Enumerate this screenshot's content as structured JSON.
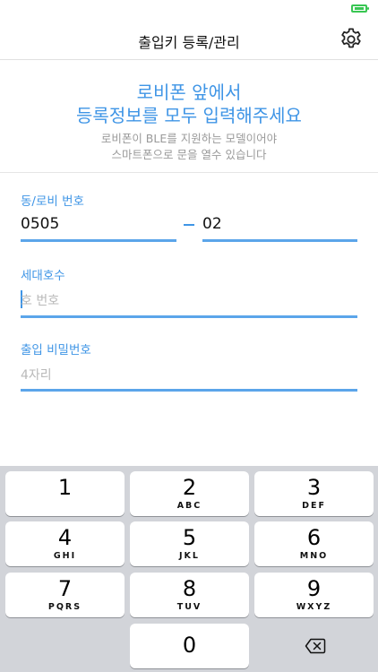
{
  "nav": {
    "title": "출입키 등록/관리",
    "settings_icon": "gear-icon"
  },
  "intro": {
    "headline_line1": "로비폰 앞에서",
    "headline_line2": "등록정보를 모두 입력해주세요",
    "sub_line1": "로비폰이 BLE를 지원하는 모델이어야",
    "sub_line2": "스마트폰으로 문을 열수 있습니다"
  },
  "form": {
    "dong_lobby": {
      "label": "동/로비 번호",
      "dong_value": "0505",
      "separator": "–",
      "lobby_value": "02"
    },
    "unit": {
      "label": "세대호수",
      "placeholder": "호 번호",
      "value": ""
    },
    "password": {
      "label": "출입 비밀번호",
      "placeholder": "4자리",
      "value": ""
    }
  },
  "keyboard": {
    "keys": [
      {
        "num": "1",
        "letters": ""
      },
      {
        "num": "2",
        "letters": "ABC"
      },
      {
        "num": "3",
        "letters": "DEF"
      },
      {
        "num": "4",
        "letters": "GHI"
      },
      {
        "num": "5",
        "letters": "JKL"
      },
      {
        "num": "6",
        "letters": "MNO"
      },
      {
        "num": "7",
        "letters": "PQRS"
      },
      {
        "num": "8",
        "letters": "TUV"
      },
      {
        "num": "9",
        "letters": "WXYZ"
      },
      {
        "num": "0",
        "letters": ""
      }
    ],
    "delete_icon": "backspace-icon"
  },
  "colors": {
    "accent": "#3f95e6",
    "battery": "#39c653",
    "keyboard_bg": "#d2d4d9"
  }
}
